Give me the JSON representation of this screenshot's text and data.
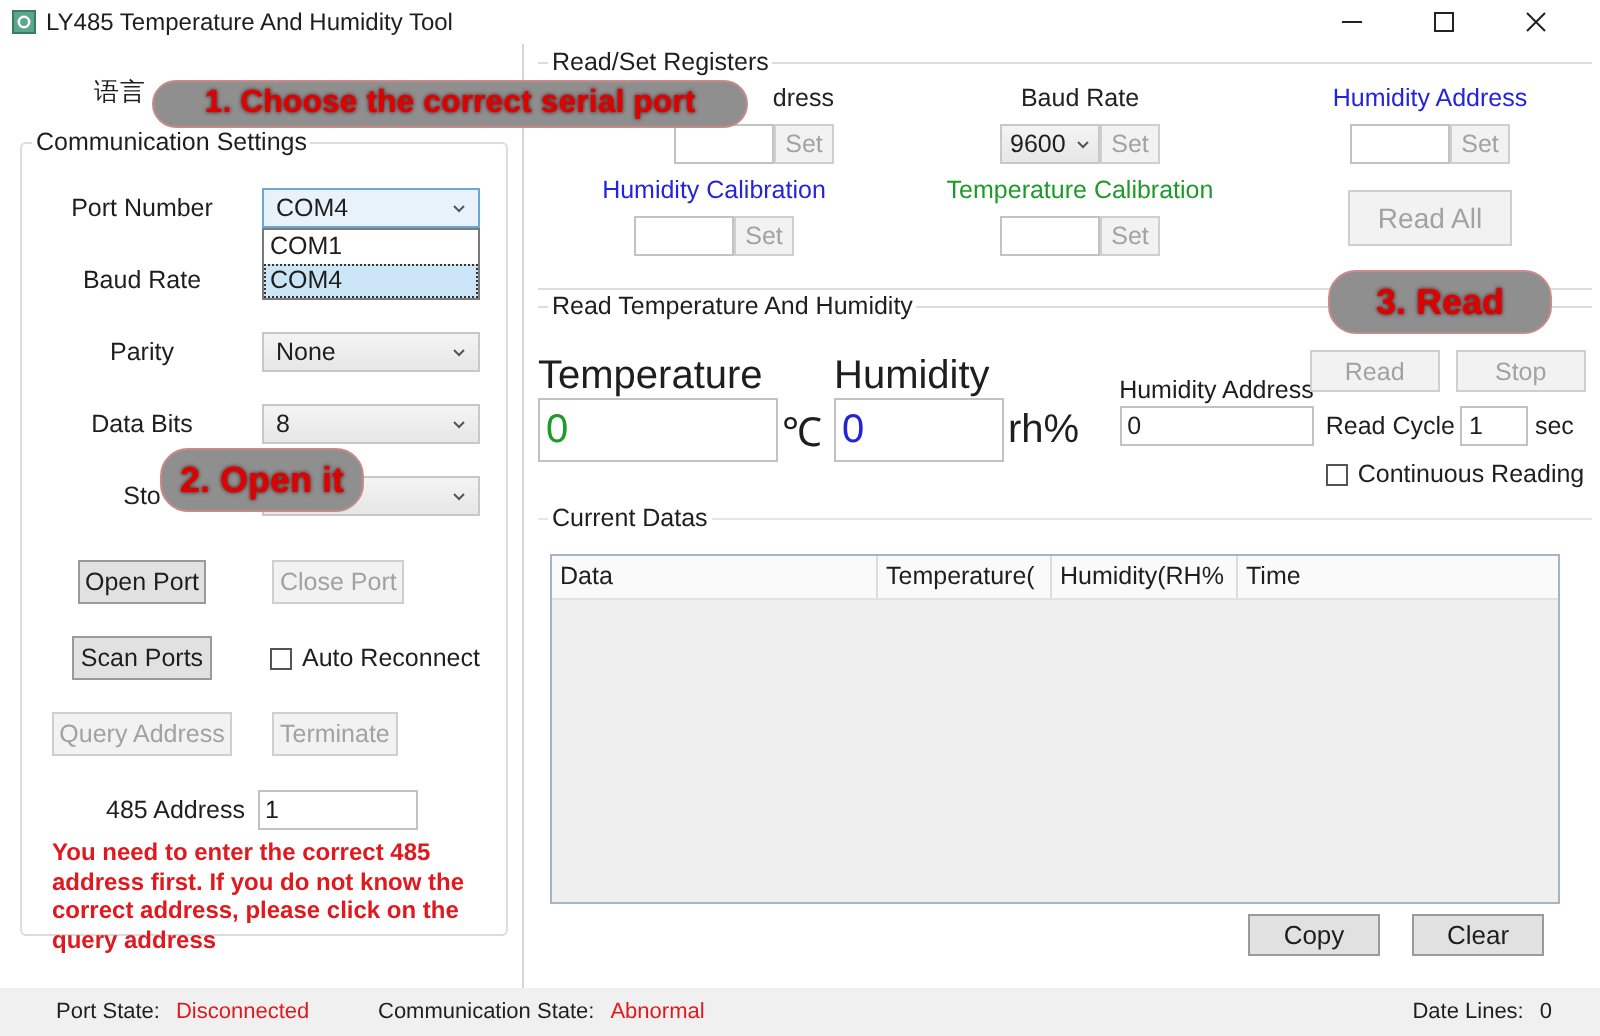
{
  "window": {
    "title": "LY485 Temperature And Humidity Tool"
  },
  "language": {
    "label": "语言"
  },
  "communication_settings": {
    "title": "Communication Settings",
    "fields": [
      {
        "label": "Port Number",
        "value": "COM4",
        "expanded": true,
        "options": [
          {
            "label": "COM1",
            "selected": false
          },
          {
            "label": "COM4",
            "selected": true
          }
        ]
      },
      {
        "label": "Baud Rate",
        "expanded": false
      },
      {
        "label": "Parity",
        "value": "None",
        "expanded": false
      },
      {
        "label": "Data Bits",
        "value": "8",
        "expanded": false
      },
      {
        "label": "Sto",
        "expanded": false
      }
    ],
    "buttons": [
      {
        "label": "Open Port",
        "disabled": false
      },
      {
        "label": "Close Port",
        "disabled": true
      },
      {
        "label": "Scan Ports",
        "disabled": false
      },
      {
        "label": "Query Address",
        "disabled": true
      },
      {
        "label": "Terminate",
        "disabled": true
      }
    ],
    "auto_reconnect": {
      "label": "Auto Reconnect",
      "checked": false
    },
    "address": {
      "label": "485 Address",
      "value": "1"
    },
    "warning": "You need to enter the correct 485 address first. If you do not know the correct address, please click on the query address"
  },
  "registers": {
    "title": "Read/Set Registers",
    "items": [
      {
        "kind": "input",
        "label": "dress",
        "color": "#222222",
        "button": {
          "label": "Set",
          "disabled": true
        }
      },
      {
        "kind": "select",
        "label": "Baud Rate",
        "color": "#222222",
        "value": "9600",
        "button": {
          "label": "Set",
          "disabled": true
        }
      },
      {
        "kind": "input",
        "label": "Humidity Address",
        "color": "#2424d8",
        "button": {
          "label": "Set",
          "disabled": true
        }
      },
      {
        "kind": "input",
        "label": "Humidity Calibration",
        "color": "#2424d8",
        "button": {
          "label": "Set",
          "disabled": true
        }
      },
      {
        "kind": "input",
        "label": "Temperature Calibration",
        "color": "#1e9a2a",
        "button": {
          "label": "Set",
          "disabled": true
        }
      },
      {
        "kind": "button",
        "label": "Read All",
        "disabled": true
      }
    ]
  },
  "reading": {
    "title": "Read Temperature And Humidity",
    "temperature": {
      "label": "Temperature",
      "value": "0",
      "unit": "℃"
    },
    "humidity": {
      "label": "Humidity",
      "value": "0",
      "unit": "rh%"
    },
    "humidity_address": {
      "label": "Humidity Address",
      "value": "0"
    },
    "buttons": [
      {
        "label": "Read",
        "disabled": true
      },
      {
        "label": "Stop",
        "disabled": true
      }
    ],
    "read_cycle": {
      "label": "Read Cycle",
      "value": "1",
      "unit": "sec"
    },
    "continuous_reading": {
      "label": "Continuous Reading",
      "checked": false
    }
  },
  "current_datas": {
    "title": "Current Datas",
    "table": {
      "columns": [
        "Data",
        "Temperature(",
        "Humidity(RH%",
        "Time"
      ]
    },
    "buttons": [
      {
        "label": "Copy",
        "disabled": false
      },
      {
        "label": "Clear",
        "disabled": false
      }
    ]
  },
  "status_bar": [
    {
      "label": "Port State:",
      "value": "Disconnected",
      "alert": true
    },
    {
      "label": "Communication State:",
      "value": "Abnormal",
      "alert": true
    },
    {
      "label": "Date Lines:",
      "value": "0",
      "alert": false
    }
  ],
  "callouts": [
    {
      "text": "1. Choose the correct serial port"
    },
    {
      "text": "2. Open it"
    },
    {
      "text": "3. Read"
    }
  ]
}
